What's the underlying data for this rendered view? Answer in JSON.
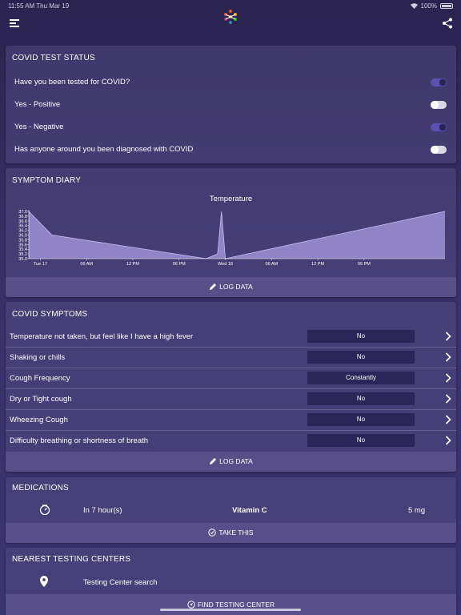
{
  "status_bar": {
    "time": "11:55 AM  Thu Mar 19",
    "battery": "100%"
  },
  "header": {
    "menu_icon": "menu-icon",
    "logo_icon": "logo-icon",
    "share_icon": "share-icon"
  },
  "covid_test_status": {
    "title": "COVID TEST STATUS",
    "items": [
      {
        "label": "Have you been tested for COVID?",
        "on": true
      },
      {
        "label": "Yes - Positive",
        "on": false
      },
      {
        "label": "Yes - Negative",
        "on": true
      },
      {
        "label": "Has anyone around you been diagnosed with COVID",
        "on": false
      }
    ]
  },
  "symptom_diary": {
    "title": "SYMPTOM DIARY",
    "log_label": "LOG DATA"
  },
  "chart_data": {
    "type": "area",
    "title": "Temperature",
    "x_ticks": [
      "Tue 17",
      "06 AM",
      "12 PM",
      "06 PM",
      "Wed 18",
      "06 AM",
      "12 PM",
      "06 PM"
    ],
    "y_ticks": [
      "37.0",
      "36.8",
      "36.6",
      "36.4",
      "36.2",
      "36.0",
      "35.8",
      "35.6",
      "35.4",
      "35.2",
      "35.0"
    ],
    "ylim": [
      35.0,
      37.0
    ],
    "series": [
      {
        "x": [
          "Tue 17 00:00",
          "Tue 17 03:00",
          "Tue 17 23:00",
          "Wed 18 00:30",
          "Wed 18 01:00",
          "Wed 18 01:30",
          "Thu 19 06:00"
        ],
        "values": [
          37.0,
          36.0,
          35.0,
          35.2,
          37.0,
          35.0,
          37.0
        ]
      }
    ],
    "grid": false,
    "legend": "none"
  },
  "covid_symptoms": {
    "title": "COVID SYMPTOMS",
    "items": [
      {
        "label": "Temperature not taken, but feel like I have a high fever",
        "value": "No"
      },
      {
        "label": "Shaking or chills",
        "value": "No"
      },
      {
        "label": "Cough Frequency",
        "value": "Constantly"
      },
      {
        "label": "Dry or Tight cough",
        "value": "No"
      },
      {
        "label": "Wheezing Cough",
        "value": "No"
      },
      {
        "label": "Difficulty breathing or shortness of breath",
        "value": "No"
      }
    ],
    "log_label": "LOG DATA"
  },
  "medications": {
    "title": "MEDICATIONS",
    "icon": "timer-icon",
    "time": "In 7 hour(s)",
    "name": "Vitamin C",
    "dose": "5 mg",
    "action_label": "TAKE THIS"
  },
  "testing_centers": {
    "title": "NEAREST TESTING CENTERS",
    "icon": "location-pin-icon",
    "search_label": "Testing Center search",
    "action_label": "FIND TESTING CENTER"
  }
}
